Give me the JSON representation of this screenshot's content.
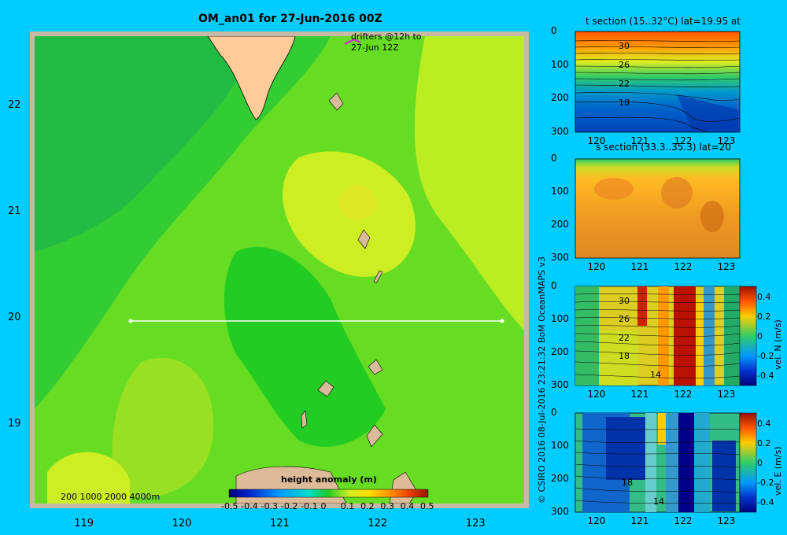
{
  "map": {
    "title": "OM_an01 for 27-Jun-2016 00Z",
    "drifters_label_line1": "drifters @12h to",
    "drifters_label_line2": "27-Jun 12Z",
    "depth_legend": "200  1000  2000  4000m",
    "colorbar_title": "height anomaly (m)",
    "colorbar_ticks": [
      "-0.5",
      "-0.4",
      "-0.3",
      "-0.2",
      "-0.1",
      "0",
      "0.1",
      "0.2",
      "0.3",
      "0.4",
      "0.5"
    ],
    "lon_ticks": [
      "119",
      "120",
      "121",
      "122",
      "123"
    ],
    "lat_ticks": [
      "22",
      "21",
      "20",
      "19"
    ]
  },
  "credit": "© CSIRO 2016   08-Jul-2016 23:21:32 BoM OceanMAPS v3",
  "panels": {
    "t_section": {
      "title": "t section (15..32°C) lat=19.95 at",
      "contour_labels": [
        "30",
        "26",
        "22",
        "18"
      ],
      "depth_ticks": [
        "0",
        "100",
        "200",
        "300"
      ],
      "lon_ticks": [
        "120",
        "121",
        "122",
        "123"
      ]
    },
    "s_section": {
      "title": "s section (33.3..35.3) lat=20",
      "depth_ticks": [
        "0",
        "100",
        "200",
        "300"
      ],
      "lon_ticks": [
        "120",
        "121",
        "122",
        "123"
      ]
    },
    "vel_n": {
      "contour_labels": [
        "30",
        "26",
        "22",
        "18",
        "14"
      ],
      "depth_ticks": [
        "0",
        "100",
        "200",
        "300"
      ],
      "lon_ticks": [
        "120",
        "121",
        "122",
        "123"
      ],
      "cbar_ticks": [
        "0.4",
        "0.2",
        "0",
        "-0.2",
        "-0.4"
      ],
      "cbar_label": "vel. N (m/s)"
    },
    "vel_e": {
      "contour_labels": [
        "18",
        "14"
      ],
      "depth_ticks": [
        "0",
        "100",
        "200",
        "300"
      ],
      "lon_ticks": [
        "120",
        "121",
        "122",
        "123"
      ],
      "cbar_ticks": [
        "0.4",
        "0.2",
        "0",
        "-0.2",
        "-0.4"
      ],
      "cbar_label": "vel. E (m/s)"
    }
  },
  "chart_data": [
    {
      "type": "heatmap",
      "title": "OM_an01 for 27-Jun-2016 00Z",
      "x_axis": "longitude",
      "y_axis": "latitude",
      "xlim": [
        118.5,
        123.5
      ],
      "ylim": [
        18.25,
        22.65
      ],
      "colorbar": {
        "label": "height anomaly (m)",
        "range": [
          -0.5,
          0.5
        ]
      },
      "section_line": {
        "lat": 20,
        "lon_from": 119.5,
        "lon_to": 123.2
      },
      "field_range_estimate": [
        0.0,
        0.1
      ]
    },
    {
      "type": "heatmap",
      "title": "t section (15..32°C) lat=19.95 at",
      "xlim": [
        119.5,
        123.3
      ],
      "ylim": [
        300,
        0
      ],
      "contours": [
        30,
        26,
        22,
        18
      ]
    },
    {
      "type": "heatmap",
      "title": "s section (33.3..35.3) lat=20",
      "xlim": [
        119.5,
        123.3
      ],
      "ylim": [
        300,
        0
      ]
    },
    {
      "type": "heatmap",
      "title": "",
      "xlim": [
        119.5,
        123.3
      ],
      "ylim": [
        300,
        0
      ],
      "colorbar": {
        "label": "vel. N (m/s)",
        "range": [
          -0.4,
          0.4
        ]
      },
      "contours": [
        30,
        26,
        22,
        18,
        14
      ]
    },
    {
      "type": "heatmap",
      "title": "",
      "xlim": [
        119.5,
        123.3
      ],
      "ylim": [
        300,
        0
      ],
      "colorbar": {
        "label": "vel. E (m/s)",
        "range": [
          -0.4,
          0.4
        ]
      },
      "contours": [
        18,
        14
      ]
    }
  ]
}
